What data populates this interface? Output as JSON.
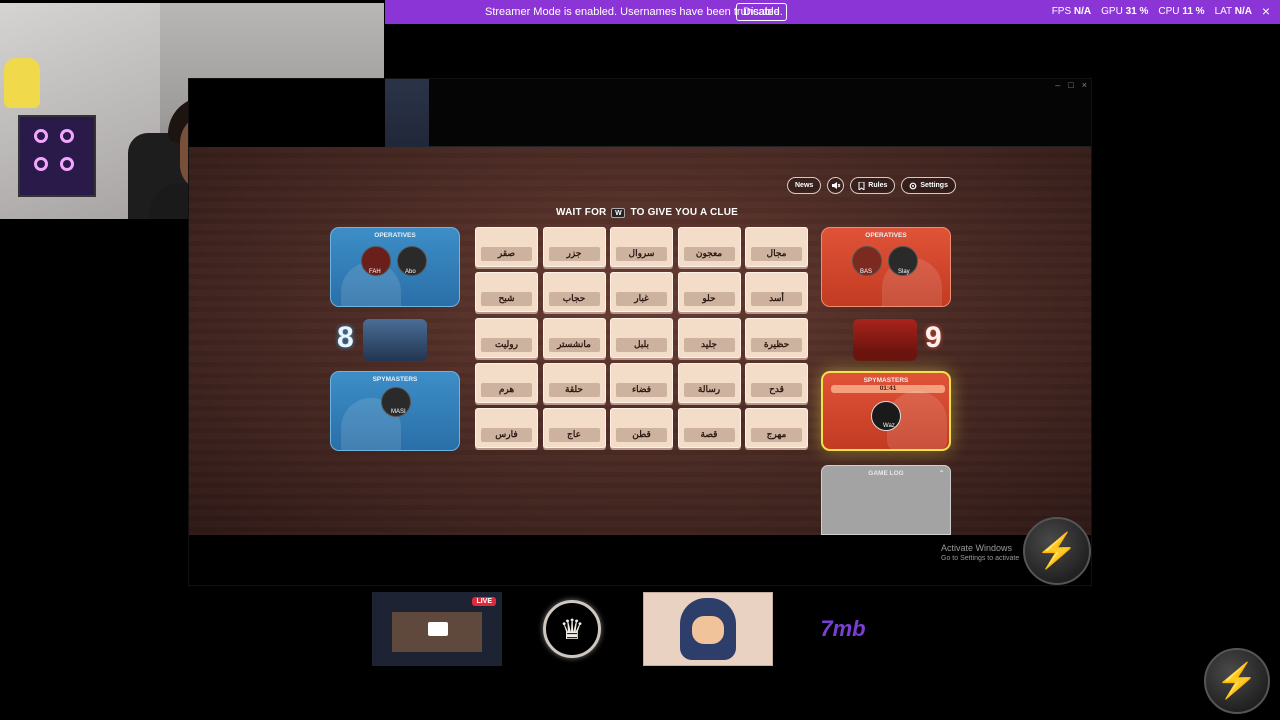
{
  "banner": {
    "message": "Streamer Mode is enabled. Usernames have been truncated.",
    "disable_label": "Disable",
    "stats": [
      {
        "label": "FPS",
        "value": "N/A"
      },
      {
        "label": "GPU",
        "value": "31 %"
      },
      {
        "label": "CPU",
        "value": "11 %"
      },
      {
        "label": "LAT",
        "value": "N/A"
      }
    ],
    "close_icon": "×"
  },
  "window_controls": [
    "–",
    "□",
    "×"
  ],
  "toolbar": {
    "news_label": "News",
    "rules_label": "Rules",
    "settings_label": "Settings"
  },
  "clue": {
    "prefix": "WAIT FOR",
    "suffix": "TO GIVE YOU A CLUE"
  },
  "blue_team": {
    "operatives_title": "OPERATIVES",
    "operatives": [
      "FAH",
      "Abo"
    ],
    "score": "8",
    "spymasters_title": "SPYMASTERS",
    "spymaster": "MASI"
  },
  "red_team": {
    "operatives_title": "OPERATIVES",
    "operatives": [
      "BAS",
      "Slay"
    ],
    "score": "9",
    "spymasters_title": "SPYMASTERS",
    "timer": "01:41",
    "spymaster": "Waz"
  },
  "cards": [
    "صقر",
    "جزر",
    "سروال",
    "معجون",
    "مجال",
    "شبح",
    "حجاب",
    "غبار",
    "حلو",
    "أسد",
    "روليت",
    "مانشستر",
    "بلبل",
    "جليد",
    "حظيرة",
    "هرم",
    "حلقة",
    "فضاء",
    "رسالة",
    "قدح",
    "فارس",
    "عاج",
    "قطن",
    "قصة",
    "مهرج"
  ],
  "game_log": {
    "title": "GAME LOG"
  },
  "watermark": {
    "line1": "Activate Windows",
    "line2": "Go to Settings to activate"
  },
  "thumbnails": {
    "live_label": "LIVE",
    "brand_text": "7mb"
  },
  "colors": {
    "banner": "#8c35d6",
    "blue_team": "#3d8ec7",
    "red_team": "#e05338",
    "card": "#f3dcc8"
  },
  "icons": [
    "lightning-bolt-icon",
    "crown-icon",
    "bookmark-icon",
    "gear-icon",
    "speaker-muted-icon"
  ]
}
